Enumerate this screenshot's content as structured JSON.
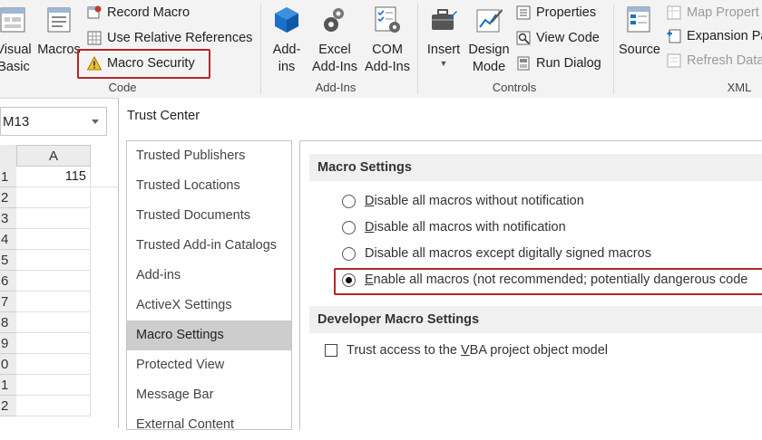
{
  "ribbon": {
    "code": {
      "group_label": "Code",
      "visual_basic_l1": "Visual",
      "visual_basic_l2": "Basic",
      "macros_label": "Macros",
      "record_macro": "Record Macro",
      "relative_refs": "Use Relative References",
      "macro_security": "Macro Security"
    },
    "addins": {
      "group_label": "Add-Ins",
      "addins_l1": "Add-",
      "addins_l2": "ins",
      "excel_addins_l1": "Excel",
      "excel_addins_l2": "Add-Ins",
      "com_addins_l1": "COM",
      "com_addins_l2": "Add-Ins"
    },
    "controls": {
      "group_label": "Controls",
      "insert": "Insert",
      "design_l1": "Design",
      "design_l2": "Mode",
      "properties": "Properties",
      "view_code": "View Code",
      "run_dialog": "Run Dialog"
    },
    "xml": {
      "group_label": "XML",
      "source": "Source",
      "map_properties": "Map Propert",
      "expansion_packs": "Expansion Pa",
      "refresh_data": "Refresh Data"
    }
  },
  "sheet": {
    "name_box": "M13",
    "column_header": "A",
    "rows": [
      "1",
      "2",
      "3",
      "4",
      "5",
      "6",
      "7",
      "8",
      "9",
      "0",
      "1",
      "2"
    ],
    "cell_a1": "115"
  },
  "dialog": {
    "title": "Trust Center",
    "nav": [
      "Trusted Publishers",
      "Trusted Locations",
      "Trusted Documents",
      "Trusted Add-in Catalogs",
      "Add-ins",
      "ActiveX Settings",
      "Macro Settings",
      "Protected View",
      "Message Bar",
      "External Content"
    ],
    "selected_nav": "Macro Settings",
    "macro_settings_header": "Macro Settings",
    "options": [
      {
        "pre": "",
        "u": "D",
        "post": "isable all macros without notification",
        "selected": false
      },
      {
        "pre": "",
        "u": "D",
        "post": "isable all macros with notification",
        "selected": false
      },
      {
        "pre": "Disable all macros except di",
        "u": "g",
        "post": "itally signed macros",
        "selected": false
      },
      {
        "pre": "",
        "u": "E",
        "post": "nable all macros (not recommended; potentially dangerous code",
        "selected": true
      }
    ],
    "developer_header": "Developer Macro Settings",
    "trust_vba": {
      "pre": "Trust access to the ",
      "u": "V",
      "post": "BA project object model",
      "checked": false
    }
  },
  "colors": {
    "highlight_border": "#b3262b",
    "selected_nav_bg": "#cdcdcd",
    "ribbon_bg": "#f3f3f3",
    "icon_blue": "#1a6fc9"
  }
}
